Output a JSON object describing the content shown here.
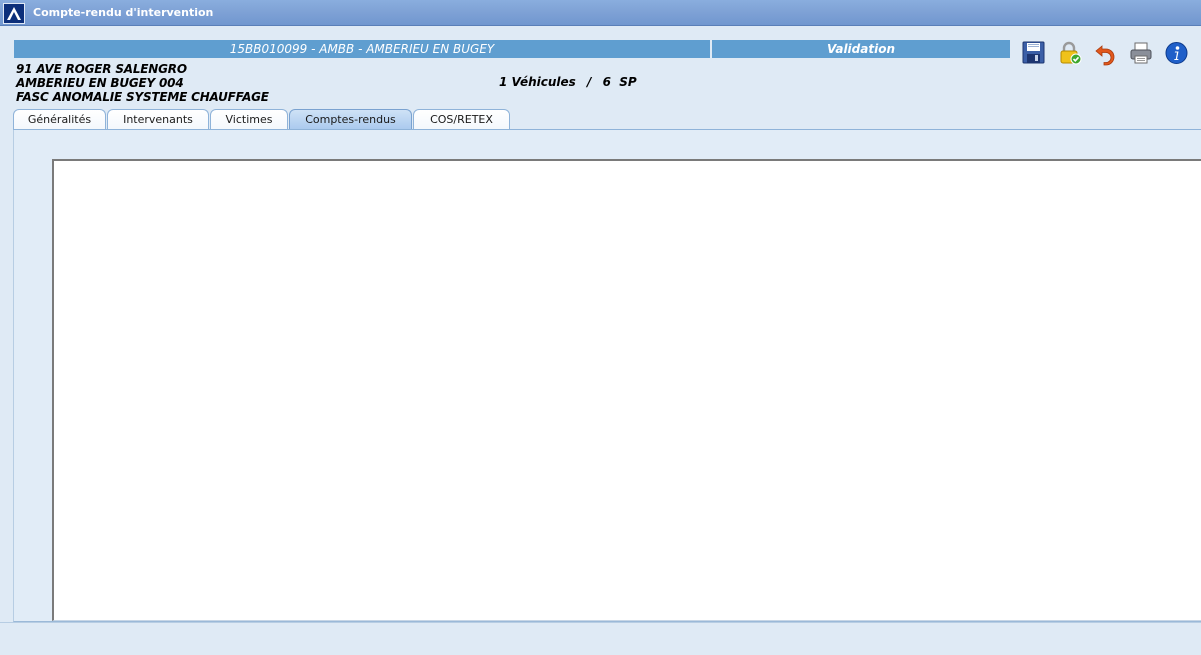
{
  "window": {
    "title": "Compte-rendu d'intervention",
    "logo_icon": "app-logo-icon"
  },
  "header": {
    "intervention": "15BB010099 - AMBB - AMBERIEU EN BUGEY",
    "status": "Validation"
  },
  "toolbar": {
    "icons": [
      "save-icon",
      "lock-icon",
      "undo-icon",
      "print-icon",
      "info-icon"
    ]
  },
  "info": {
    "address_line1": "91 AVE ROGER SALENGRO",
    "address_line2": "AMBERIEU EN BUGEY 004",
    "incident": "FASC ANOMALIE SYSTEME CHAUFFAGE",
    "vehicles_count": "1 Véhicules",
    "separator": "/",
    "personnel": "6  SP"
  },
  "tabs": [
    {
      "label": "Généralités",
      "active": false
    },
    {
      "label": "Intervenants",
      "active": false
    },
    {
      "label": "Victimes",
      "active": false
    },
    {
      "label": "Comptes-rendus",
      "active": true
    },
    {
      "label": "COS/RETEX",
      "active": false
    }
  ],
  "colors": {
    "accent": "#5f9ed0",
    "title_bar": "#7fa2d6",
    "background": "#dfeaf5"
  }
}
